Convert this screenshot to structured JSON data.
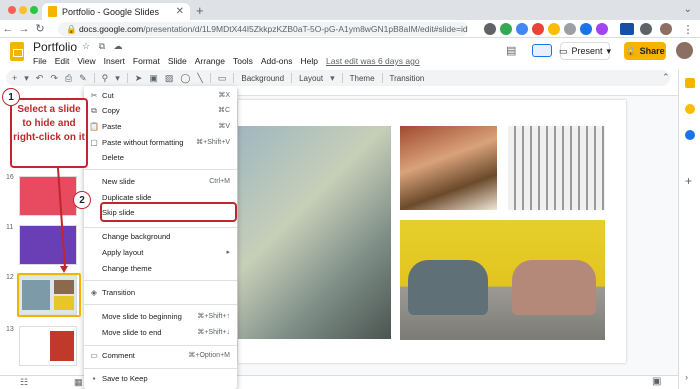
{
  "browser": {
    "tab_title": "Portfolio - Google Slides",
    "url_domain": "docs.google.com",
    "url_path": "/presentation/d/1L9MDtX44I5ZkkpzKZB0aT-5O-pG-A1ym8wGN1pB8aIM/edit#slide=id.gc6f80d1ff_0_...",
    "new_tab_symbol": "+"
  },
  "app": {
    "doc_title": "Portfolio",
    "menu": [
      "File",
      "Edit",
      "View",
      "Insert",
      "Format",
      "Slide",
      "Arrange",
      "Tools",
      "Add-ons",
      "Help"
    ],
    "last_edit": "Last edit was 6 days ago",
    "present_label": "Present",
    "share_label": "Share"
  },
  "toolbar": {
    "background": "Background",
    "layout": "Layout",
    "theme": "Theme",
    "transition": "Transition"
  },
  "filmstrip": {
    "slide_numbers": [
      "16",
      "11",
      "12",
      "13"
    ]
  },
  "context_menu": {
    "items": [
      {
        "label": "Cut",
        "shortcut": "⌘X",
        "icon": "scissors-icon"
      },
      {
        "label": "Copy",
        "shortcut": "⌘C",
        "icon": "copy-icon"
      },
      {
        "label": "Paste",
        "shortcut": "⌘V",
        "icon": "paste-icon"
      },
      {
        "label": "Paste without formatting",
        "shortcut": "⌘+Shift+V",
        "icon": "paste-plain-icon"
      },
      {
        "label": "Delete",
        "shortcut": "",
        "icon": ""
      },
      {
        "label": "New slide",
        "shortcut": "Ctrl+M",
        "icon": ""
      },
      {
        "label": "Duplicate slide",
        "shortcut": "",
        "icon": ""
      },
      {
        "label": "Skip slide",
        "shortcut": "",
        "icon": ""
      },
      {
        "label": "Change background",
        "shortcut": "",
        "icon": ""
      },
      {
        "label": "Apply layout",
        "shortcut": "▸",
        "icon": ""
      },
      {
        "label": "Change theme",
        "shortcut": "",
        "icon": ""
      },
      {
        "label": "Transition",
        "shortcut": "",
        "icon": "transition-icon"
      },
      {
        "label": "Move slide to beginning",
        "shortcut": "⌘+Shift+↑",
        "icon": ""
      },
      {
        "label": "Move slide to end",
        "shortcut": "⌘+Shift+↓",
        "icon": ""
      },
      {
        "label": "Comment",
        "shortcut": "⌘+Option+M",
        "icon": "comment-icon"
      },
      {
        "label": "Save to Keep",
        "shortcut": "",
        "icon": "keep-icon"
      }
    ]
  },
  "annotations": {
    "step1_number": "1",
    "step1_text": "Select a slide to hide and right-click on it",
    "step2_number": "2"
  },
  "colors": {
    "accent_yellow": "#f4b400",
    "annotation_red": "#c0272d",
    "toolbar_bg": "#f1f3f4"
  }
}
